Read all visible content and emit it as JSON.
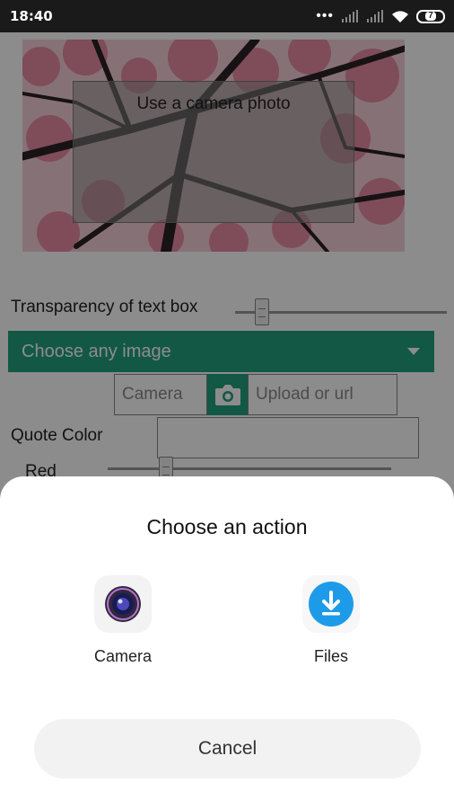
{
  "status_bar": {
    "time": "18:40",
    "battery": "7"
  },
  "app": {
    "photo_text": "Use a camera photo",
    "transparency_label": "Transparency of text box",
    "transparency_value": 0.09,
    "image_chooser": {
      "selected": "Choose any image"
    },
    "camera_input": {
      "placeholder": "Camera"
    },
    "url_input": {
      "placeholder": "Upload or url"
    },
    "quote_color_label": "Quote Color",
    "red_label": "Red",
    "red_value": 0.2
  },
  "sheet": {
    "title": "Choose an action",
    "actions": [
      {
        "label": "Camera",
        "icon": "camera-app-icon"
      },
      {
        "label": "Files",
        "icon": "download-files-icon"
      }
    ],
    "cancel_label": "Cancel"
  },
  "colors": {
    "accent": "#22a07e",
    "files_blue": "#1e9be8",
    "status_bar": "#1a1a1a"
  }
}
